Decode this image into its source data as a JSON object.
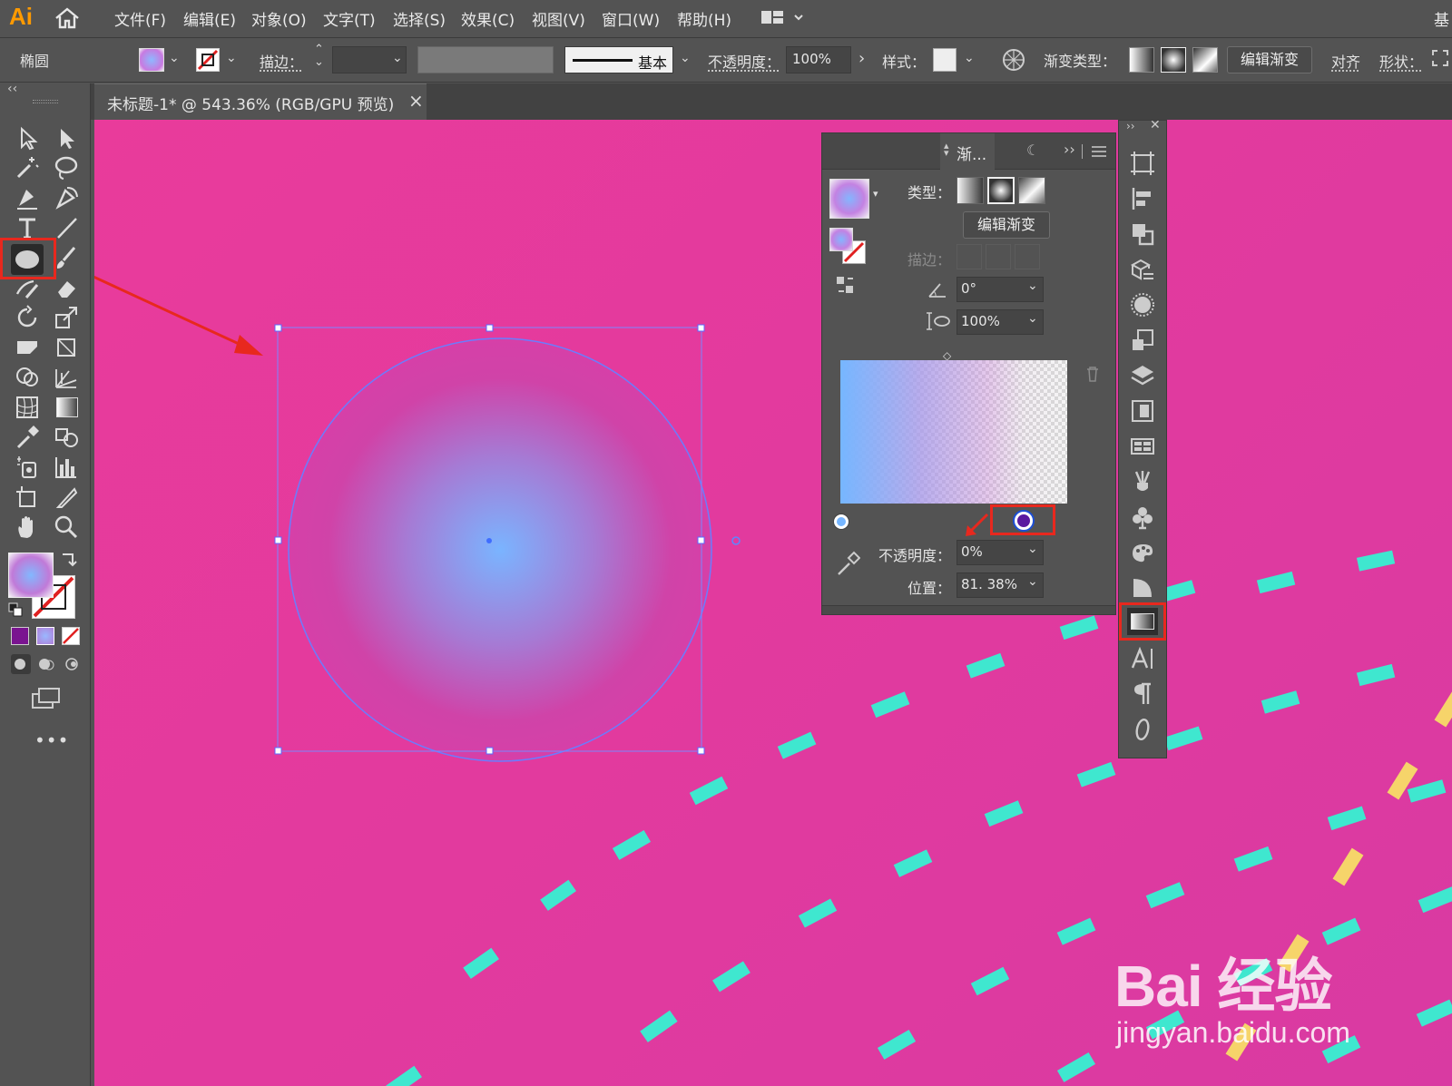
{
  "app": {
    "logo": "Ai"
  },
  "menu": [
    "文件(F)",
    "编辑(E)",
    "对象(O)",
    "文字(T)",
    "选择(S)",
    "效果(C)",
    "视图(V)",
    "窗口(W)",
    "帮助(H)"
  ],
  "workspace_label": "基",
  "control_bar": {
    "object_label": "椭圆",
    "stroke_label": "描边：",
    "brush_label": "基本",
    "opacity_label": "不透明度：",
    "opacity_value": "100%",
    "style_label": "样式：",
    "gradient_type_label": "渐变类型：",
    "edit_gradient_button": "编辑渐变",
    "align_label": "对齐",
    "shape_label": "形状："
  },
  "document_tab": {
    "title": "未标题-1* @ 543.36% (RGB/GPU 预览)",
    "close": "×"
  },
  "collapse_glyph": "‹‹",
  "gradient_panel": {
    "tab_label": "渐...",
    "type_label": "类型：",
    "edit_gradient_button": "编辑渐变",
    "stroke_label": "描边：",
    "angle_value": "0°",
    "aspect_value": "100%",
    "opacity_label": "不透明度：",
    "opacity_value": "0%",
    "location_label": "位置：",
    "location_value": "81. 38%",
    "stop_colors": [
      "#76b6ff",
      "#5a1aa0"
    ]
  },
  "icon_strip": [
    "artboards-icon",
    "align-icon",
    "pathfinder-icon",
    "transform-icon",
    "appearance-icon",
    "graphic-styles-icon",
    "layers-icon",
    "asset-export-icon",
    "swatches-icon",
    "brushes-icon",
    "symbols-icon",
    "color-guide-icon",
    "transparency-icon",
    "gradient-icon",
    "character-icon",
    "paragraph-icon",
    "opentype-icon"
  ],
  "colors": {
    "canvas": "#e53a9d",
    "accent_cyan": "#3fe7cf",
    "accent_yellow": "#f6d46a",
    "highlight": "#e8281e",
    "gradient_center": "#7ab4ff"
  },
  "watermark": {
    "brand": "Bai 经验",
    "url": "jingyan.baidu.com"
  }
}
